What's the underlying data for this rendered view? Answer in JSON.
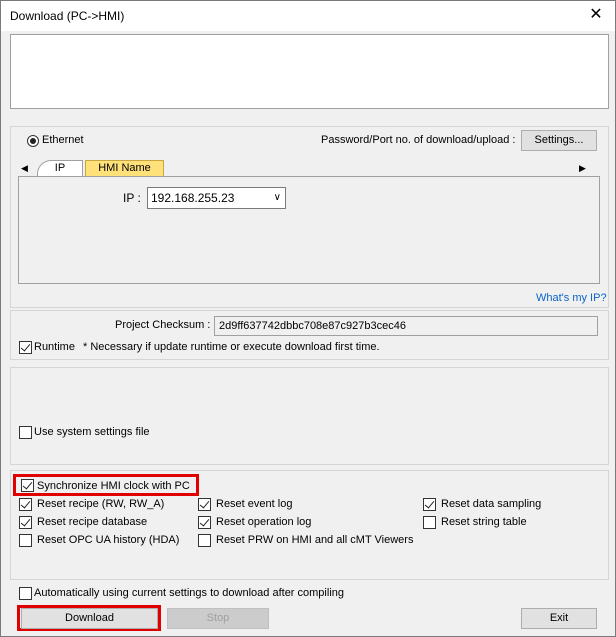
{
  "window": {
    "title": "Download (PC->HMI)",
    "close_icon": "close-icon"
  },
  "connection": {
    "ethernet_label": "Ethernet",
    "password_label": "Password/Port no. of download/upload :",
    "settings_button": "Settings...",
    "tabs": [
      {
        "label": "IP"
      },
      {
        "label": "HMI Name"
      }
    ],
    "ip_label": "IP :",
    "ip_value": "192.168.255.23",
    "whats_my_ip": "What's my IP?"
  },
  "checksum": {
    "label": "Project Checksum :",
    "value": "2d9ff637742dbbc708e87c927b3cec46"
  },
  "runtime": {
    "label": "Runtime",
    "checked": true,
    "note": "* Necessary if update runtime or execute download first time."
  },
  "system_settings": {
    "label": "Use system settings file",
    "checked": false
  },
  "options": {
    "sync_clock": {
      "label": "Synchronize HMI clock with PC",
      "checked": true
    },
    "items": [
      {
        "label": "Reset recipe (RW, RW_A)",
        "checked": true
      },
      {
        "label": "Reset event log",
        "checked": true
      },
      {
        "label": "Reset data sampling",
        "checked": true
      },
      {
        "label": "Reset recipe database",
        "checked": true
      },
      {
        "label": "Reset operation log",
        "checked": true
      },
      {
        "label": "Reset string table",
        "checked": false
      },
      {
        "label": "Reset OPC UA history (HDA)",
        "checked": false
      },
      {
        "label": "Reset PRW on HMI and all cMT Viewers",
        "checked": false
      }
    ]
  },
  "auto_download": {
    "label": "Automatically using current settings to download after compiling",
    "checked": false
  },
  "buttons": {
    "download": "Download",
    "stop": "Stop",
    "exit": "Exit"
  },
  "colors": {
    "highlight": "#e00000",
    "link": "#0a63c9",
    "tab_active": "#ffffff",
    "tab_inactive": "#ffe17a"
  }
}
